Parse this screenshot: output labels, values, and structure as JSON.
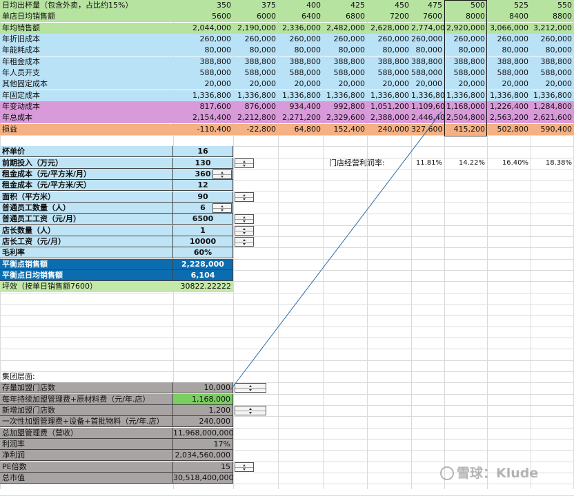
{
  "colors": {
    "green": "#b6e3a0",
    "blue": "#b9e2f7",
    "purple": "#d99ad9",
    "orange": "#f4b183",
    "blue_light": "#bfe4f6",
    "blue_dark": "#0b6db0",
    "green_light": "#c4e8a8",
    "gray": "#a9a4a4",
    "green_bright": "#7ccd62",
    "line": "#2b6aa8",
    "grid": "#dadada"
  },
  "cup_volumes": [
    "350",
    "375",
    "400",
    "425",
    "450",
    "475",
    "500",
    "525",
    "550"
  ],
  "rows": [
    {
      "label": "日均出杯量（包含外卖，占比约15%）",
      "color": "green",
      "values": [
        "350",
        "375",
        "400",
        "425",
        "450",
        "475",
        "500",
        "525",
        "550"
      ]
    },
    {
      "label": "单店日均销售额",
      "color": "green",
      "values": [
        "5600",
        "6000",
        "6400",
        "6800",
        "7200",
        "7600",
        "8000",
        "8400",
        "8800"
      ]
    },
    {
      "label": "年均销售额",
      "color": "green",
      "values": [
        "2,044,000",
        "2,190,000",
        "2,336,000",
        "2,482,000",
        "2,628,000",
        "2,774,000",
        "2,920,000",
        "3,066,000",
        "3,212,000"
      ]
    },
    {
      "label": "年折旧成本",
      "color": "blue",
      "values": [
        "260,000",
        "260,000",
        "260,000",
        "260,000",
        "260,000",
        "260,000",
        "260,000",
        "260,000",
        "260,000"
      ]
    },
    {
      "label": "年能耗成本",
      "color": "blue",
      "values": [
        "80,000",
        "80,000",
        "80,000",
        "80,000",
        "80,000",
        "80,000",
        "80,000",
        "80,000",
        "80,000"
      ]
    },
    {
      "label": "年租金成本",
      "color": "blue",
      "values": [
        "388,800",
        "388,800",
        "388,800",
        "388,800",
        "388,800",
        "388,800",
        "388,800",
        "388,800",
        "388,800"
      ]
    },
    {
      "label": "年人员开支",
      "color": "blue",
      "values": [
        "588,000",
        "588,000",
        "588,000",
        "588,000",
        "588,000",
        "588,000",
        "588,000",
        "588,000",
        "588,000"
      ]
    },
    {
      "label": "其他固定成本",
      "color": "blue",
      "values": [
        "20,000",
        "20,000",
        "20,000",
        "20,000",
        "20,000",
        "20,000",
        "20,000",
        "20,000",
        "20,000"
      ]
    },
    {
      "label": "年固定成本",
      "color": "blue",
      "values": [
        "1,336,800",
        "1,336,800",
        "1,336,800",
        "1,336,800",
        "1,336,800",
        "1,336,800",
        "1,336,800",
        "1,336,800",
        "1,336,800"
      ]
    },
    {
      "label": "年变动成本",
      "color": "purple",
      "values": [
        "817,600",
        "876,000",
        "934,400",
        "992,800",
        "1,051,200",
        "1,109,600",
        "1,168,000",
        "1,226,400",
        "1,284,800"
      ]
    },
    {
      "label": "年总成本",
      "color": "purple",
      "values": [
        "2,154,400",
        "2,212,800",
        "2,271,200",
        "2,329,600",
        "2,388,000",
        "2,446,400",
        "2,504,800",
        "2,563,200",
        "2,621,600"
      ]
    },
    {
      "label": "损益",
      "color": "orange",
      "values": [
        "-110,400",
        "-22,800",
        "64,800",
        "152,400",
        "240,000",
        "327,600",
        "415,200",
        "502,800",
        "590,400"
      ]
    }
  ],
  "params": [
    {
      "label": "杯单价",
      "value": "16",
      "style": "light",
      "spin": false
    },
    {
      "label": "前期投入（万元）",
      "value": "130",
      "style": "light",
      "spin": true
    },
    {
      "label": "租金成本（元/平方米/月）",
      "value": "360",
      "style": "light",
      "spin": true
    },
    {
      "label": "租金成本（元/平方米/天）",
      "value": "12",
      "style": "light",
      "spin": false
    },
    {
      "label": "面积（平方米）",
      "value": "90",
      "style": "light",
      "spin": true
    },
    {
      "label": "普通员工数量（人）",
      "value": "6",
      "style": "light",
      "spin": true
    },
    {
      "label": "普通员工工资（元/月）",
      "value": "6500",
      "style": "light",
      "spin": true
    },
    {
      "label": "店长数量（人）",
      "value": "1",
      "style": "light",
      "spin": true
    },
    {
      "label": "店长工资（元/月）",
      "value": "10000",
      "style": "light",
      "spin": true
    },
    {
      "label": "毛利率",
      "value": "60%",
      "style": "light",
      "spin": false
    },
    {
      "label": "平衡点销售额",
      "value": "2,228,000",
      "style": "dark",
      "spin": false
    },
    {
      "label": "平衡点日均销售额",
      "value": "6,104",
      "style": "dark",
      "spin": false
    },
    {
      "label": "坪效（按单日销售额7600）",
      "value": "30822.22222",
      "style": "greenlight",
      "spin": false
    }
  ],
  "profit_margin": {
    "label": "门店经营利润率:",
    "values": [
      "11.81%",
      "14.22%",
      "16.40%",
      "18.38%"
    ]
  },
  "group": {
    "title": "集团层面:",
    "rows": [
      {
        "label": "存量加盟门店数",
        "value": "10,000",
        "spin": true,
        "highlight": false
      },
      {
        "label": "每年持续加盟管理费+原材料费（元/年.店）",
        "value": "1,168,000",
        "spin": false,
        "highlight": true
      },
      {
        "label": "新增加盟门店数",
        "value": "1,200",
        "spin": true,
        "highlight": false
      },
      {
        "label": "一次性加盟管理费+设备+首批物料（元/年.店）",
        "value": "240,000",
        "spin": false,
        "highlight": false
      },
      {
        "label": "总加盟管理费（营收）",
        "value": "11,968,000,000",
        "spin": false,
        "highlight": false
      },
      {
        "label": "利润率",
        "value": "17%",
        "spin": false,
        "highlight": false
      },
      {
        "label": "净利润",
        "value": "2,034,560,000",
        "spin": false,
        "highlight": false
      },
      {
        "label": "PE倍数",
        "value": "15",
        "spin": true,
        "highlight": false
      },
      {
        "label": "总市值",
        "value": "30,518,400,000",
        "spin": false,
        "highlight": false
      }
    ]
  },
  "watermark": "雪球：Klude"
}
